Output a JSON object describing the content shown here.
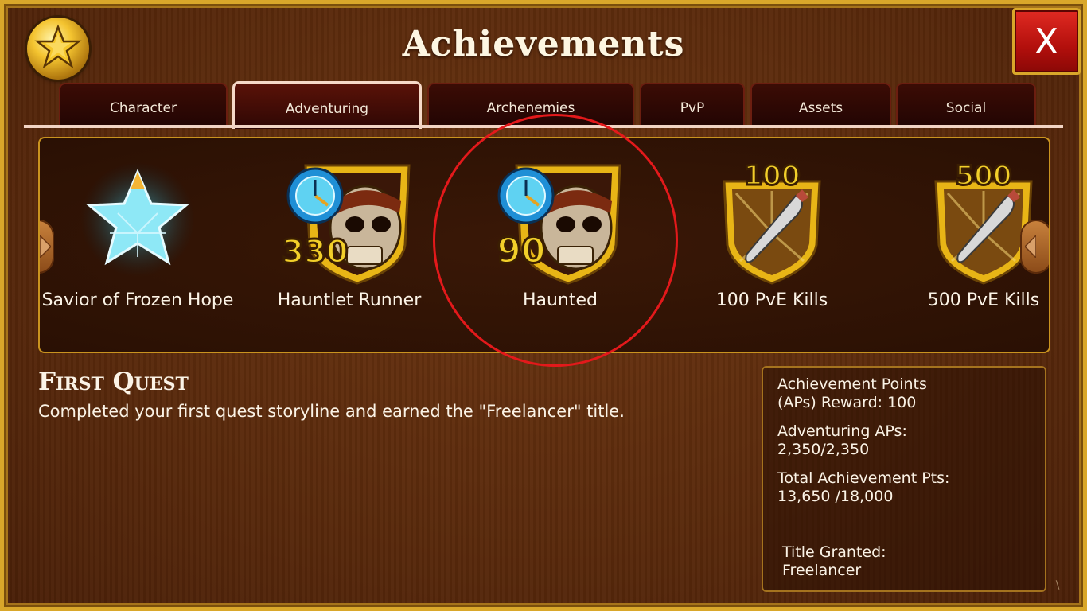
{
  "window": {
    "title": "Achievements",
    "close_label": "X"
  },
  "tabs": [
    {
      "label": "Character"
    },
    {
      "label": "Adventuring"
    },
    {
      "label": "Archenemies"
    },
    {
      "label": "PvP"
    },
    {
      "label": "Assets"
    },
    {
      "label": "Social"
    }
  ],
  "active_tab": "Adventuring",
  "carousel": {
    "items": [
      {
        "label": "Savior of Frozen Hope",
        "icon": "ice-star-icon"
      },
      {
        "label": "Hauntlet Runner",
        "icon": "skull-shield-icon",
        "badge": "330"
      },
      {
        "label": "Haunted",
        "icon": "skull-shield-icon",
        "badge": "90"
      },
      {
        "label": "100 PvE Kills",
        "icon": "dagger-shield-icon",
        "badge": "100"
      },
      {
        "label": "500 PvE Kills",
        "icon": "dagger-shield-icon",
        "badge": "500"
      }
    ]
  },
  "detail": {
    "title": "First Quest",
    "description": "Completed your first quest storyline and earned the \"Freelancer\" title."
  },
  "stats": {
    "reward_line1": "Achievement Points",
    "reward_line2": "(APs) Reward: 100",
    "adventuring_label": "Adventuring APs:",
    "adventuring_value": "2,350/2,350",
    "total_label": "Total Achievement Pts:",
    "total_value": "13,650 /18,000",
    "title_label": "Title Granted:",
    "title_value": "Freelancer"
  },
  "colors": {
    "gold_border": "#d9a72a",
    "background": "#5a2a0c",
    "close_red": "#c8140f",
    "highlight_circle": "#e3191b"
  }
}
